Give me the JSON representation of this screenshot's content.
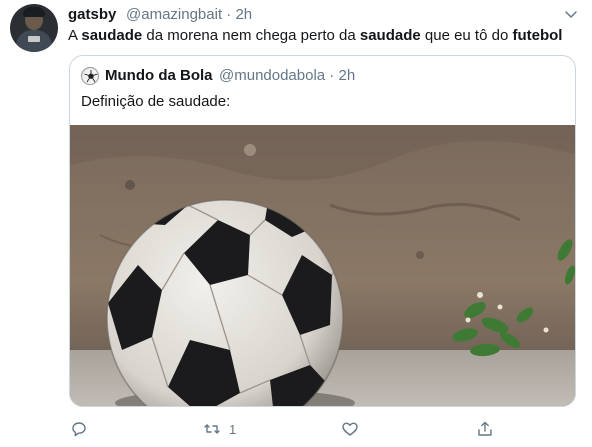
{
  "tweet": {
    "author_name": "gatsby",
    "author_handle": "@amazingbait",
    "time": "2h",
    "text_parts": [
      "A ",
      "saudade",
      " da morena nem chega perto da ",
      "saudade",
      " que eu tô do ",
      "futebol"
    ]
  },
  "quoted": {
    "author_name": "Mundo da Bola",
    "author_handle": "@mundodabola",
    "time": "2h",
    "text": "Definição de saudade:"
  },
  "actions": {
    "reply_icon": "reply-icon",
    "retweet_icon": "retweet-icon",
    "retweet_count": "1",
    "like_icon": "heart-icon",
    "share_icon": "share-icon"
  },
  "colors": {
    "text": "#14171a",
    "secondary": "#657786",
    "border": "#ccd6dd"
  }
}
